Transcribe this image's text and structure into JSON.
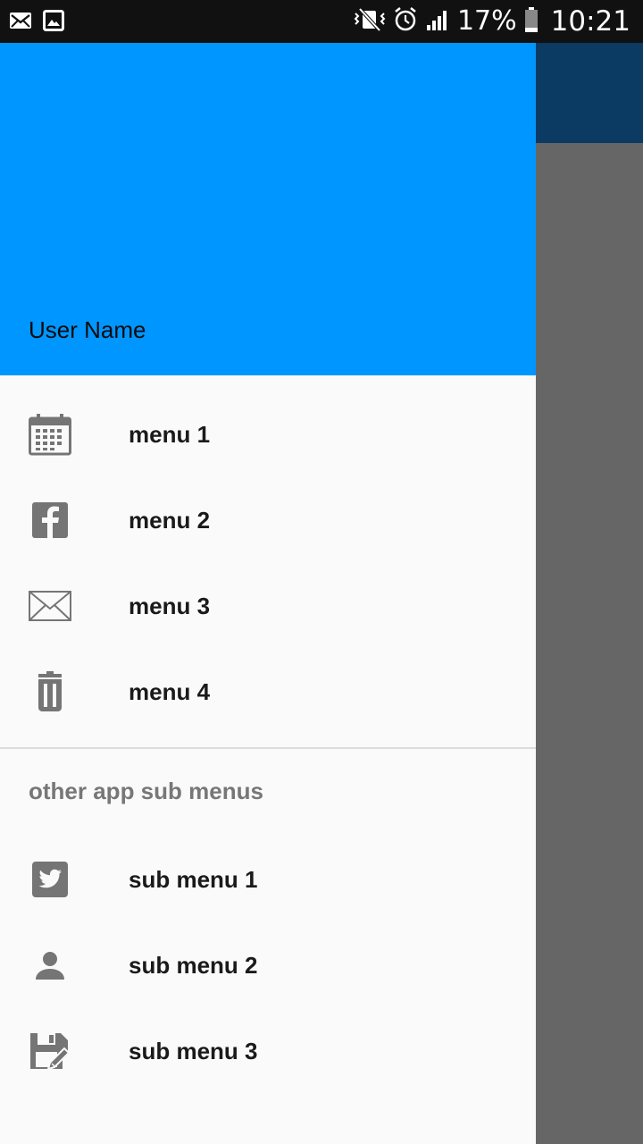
{
  "status_bar": {
    "left_icons": [
      "mail-icon",
      "image-icon"
    ],
    "right_icons": [
      "vibrate-icon",
      "alarm-icon",
      "signal-icon",
      "battery-icon"
    ],
    "battery": "17%",
    "time": "10:21"
  },
  "drawer": {
    "header_color": "#0096ff",
    "user_name": "User Name",
    "menu_items": [
      {
        "label": "menu 1",
        "icon": "calendar-icon"
      },
      {
        "label": "menu 2",
        "icon": "facebook-icon"
      },
      {
        "label": "menu 3",
        "icon": "envelope-icon"
      },
      {
        "label": "menu 4",
        "icon": "trash-icon"
      }
    ],
    "subheader": "other app sub menus",
    "sub_items": [
      {
        "label": "sub menu 1",
        "icon": "twitter-icon"
      },
      {
        "label": "sub menu 2",
        "icon": "person-icon"
      },
      {
        "label": "sub menu 3",
        "icon": "floppy-edit-icon"
      }
    ]
  },
  "colors": {
    "app_bar": "#0b3a63",
    "scrim": "#666666",
    "icon_gray": "#757575"
  }
}
